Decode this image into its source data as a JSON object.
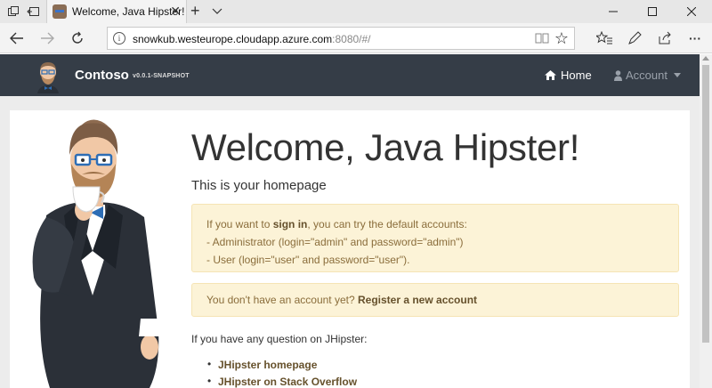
{
  "browser": {
    "tab_title": "Welcome, Java Hipster!",
    "tab_close": "✕",
    "new_tab": "+",
    "url_host": "snowkub.westeurope.cloudapp.azure.com",
    "url_rest": ":8080/#/",
    "info_glyph": "i",
    "star_glyph": "☆",
    "more_glyph": "···",
    "icons": [
      "tab-aside-icon",
      "back-tabs-icon",
      "favicon",
      "close-icon",
      "plus-icon",
      "chevron-down-icon",
      "back-arrow-icon",
      "forward-arrow-icon",
      "refresh-icon",
      "info-icon",
      "reading-view-icon",
      "star-icon",
      "favorites-list-icon",
      "pen-icon",
      "share-icon",
      "more-icon",
      "minimize-icon",
      "maximize-icon",
      "window-close-icon"
    ]
  },
  "navbar": {
    "brand": "Contoso",
    "version": "v0.0.1-SNAPSHOT",
    "home": "Home",
    "account": "Account",
    "bg_color": "#353d47"
  },
  "main": {
    "title": "Welcome, Java Hipster!",
    "subtitle": "This is your homepage",
    "alert1": {
      "pre": "If you want to ",
      "link": "sign in",
      "post": ", you can try the default accounts:",
      "line2": "- Administrator (login=\"admin\" and password=\"admin\")",
      "line3": "- User (login=\"user\" and password=\"user\")."
    },
    "alert2": {
      "text": "You don't have an account yet? ",
      "link": "Register a new account"
    },
    "question": "If you have any question on JHipster:",
    "links": [
      "JHipster homepage",
      "JHipster on Stack Overflow"
    ],
    "alert_bg": "#fcf3d7",
    "link_color": "#66512c"
  }
}
